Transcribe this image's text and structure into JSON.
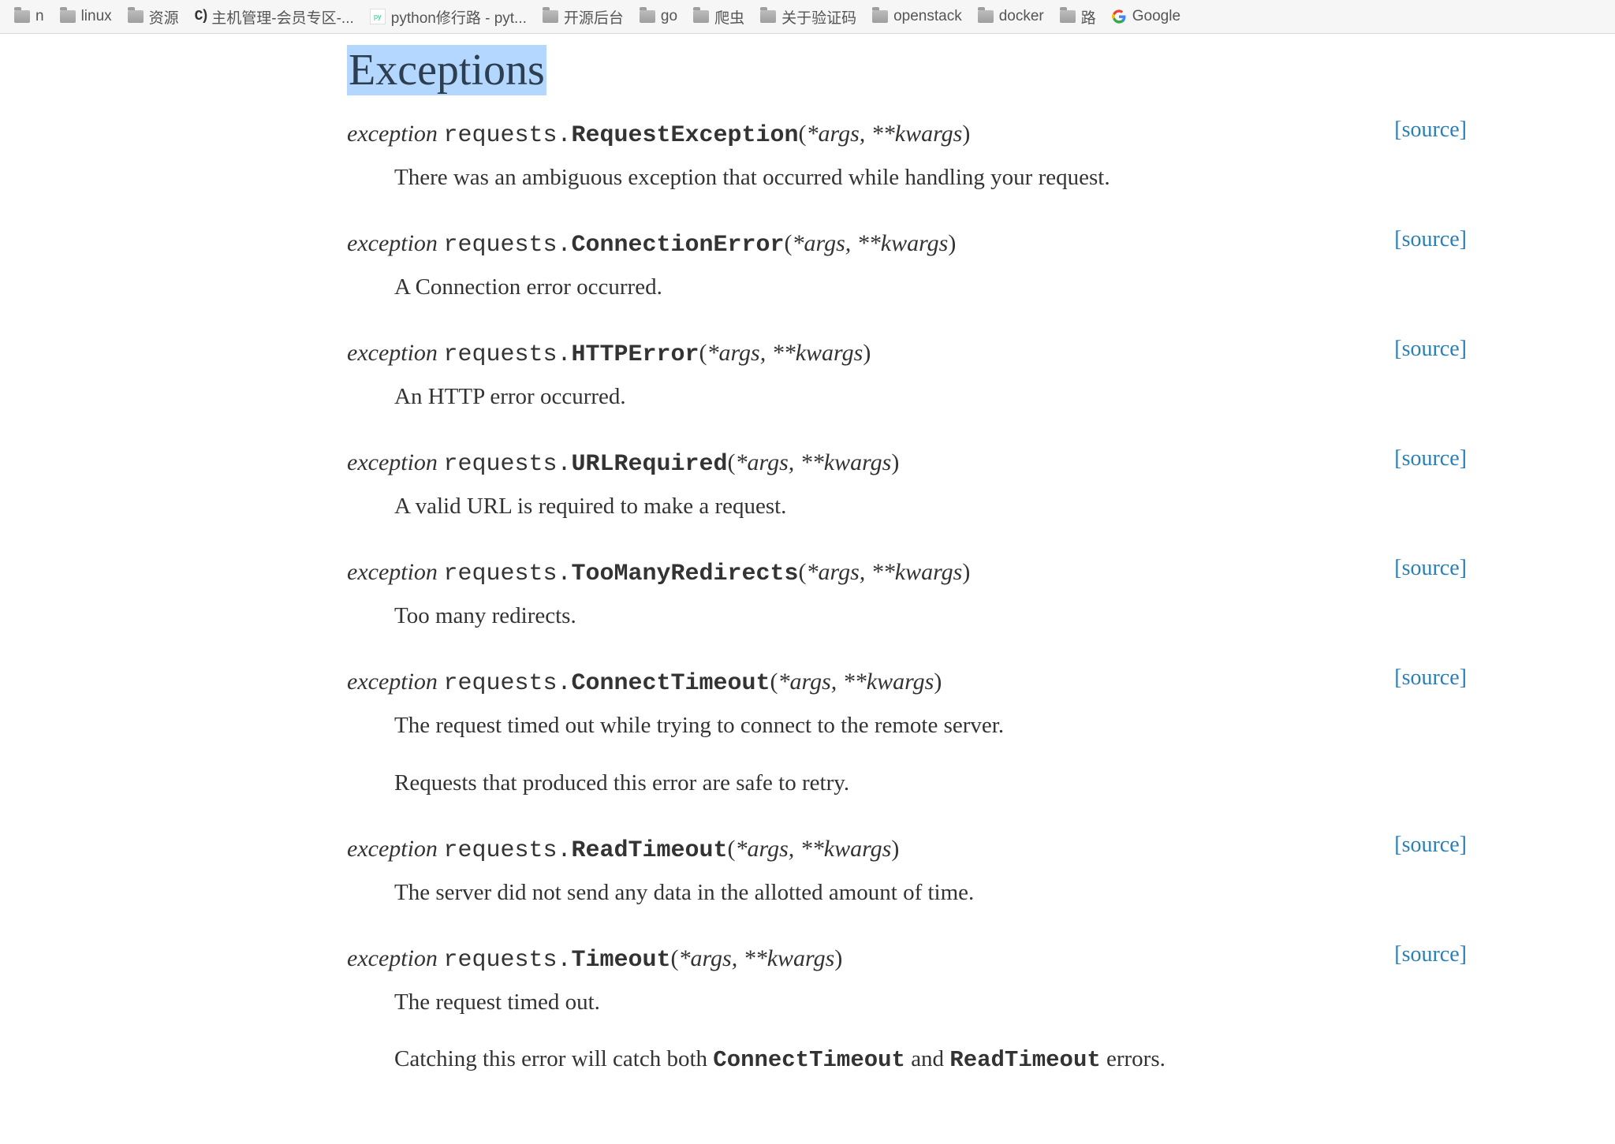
{
  "bookmarks": [
    {
      "type": "folder-fragment",
      "label": "n"
    },
    {
      "type": "folder",
      "label": "linux"
    },
    {
      "type": "folder",
      "label": "资源"
    },
    {
      "type": "c-icon",
      "label": "主机管理-会员专区-..."
    },
    {
      "type": "python-fav",
      "label": "python修行路 - pyt..."
    },
    {
      "type": "folder",
      "label": "开源后台"
    },
    {
      "type": "folder",
      "label": "go"
    },
    {
      "type": "folder",
      "label": "爬虫"
    },
    {
      "type": "folder",
      "label": "关于验证码"
    },
    {
      "type": "folder",
      "label": "openstack"
    },
    {
      "type": "folder",
      "label": "docker"
    },
    {
      "type": "folder",
      "label": "路"
    },
    {
      "type": "google",
      "label": "Google"
    }
  ],
  "heading": "Exceptions",
  "sig_keyword": "exception",
  "sig_module_prefix": "requests.",
  "sig_params": "*args, **kwargs",
  "source_label": "[source]",
  "exceptions": [
    {
      "class": "RequestException",
      "desc": [
        "There was an ambiguous exception that occurred while handling your request."
      ]
    },
    {
      "class": "ConnectionError",
      "desc": [
        "A Connection error occurred."
      ]
    },
    {
      "class": "HTTPError",
      "desc": [
        "An HTTP error occurred."
      ]
    },
    {
      "class": "URLRequired",
      "desc": [
        "A valid URL is required to make a request."
      ]
    },
    {
      "class": "TooManyRedirects",
      "desc": [
        "Too many redirects."
      ]
    },
    {
      "class": "ConnectTimeout",
      "desc": [
        "The request timed out while trying to connect to the remote server.",
        "Requests that produced this error are safe to retry."
      ]
    },
    {
      "class": "ReadTimeout",
      "desc": [
        "The server did not send any data in the allotted amount of time."
      ]
    },
    {
      "class": "Timeout",
      "desc": [
        "The request timed out."
      ],
      "desc_rich_tail": {
        "prefix": "Catching this error will catch both ",
        "code1": "ConnectTimeout",
        "mid": " and ",
        "code2": "ReadTimeout",
        "suffix": " errors."
      }
    }
  ]
}
